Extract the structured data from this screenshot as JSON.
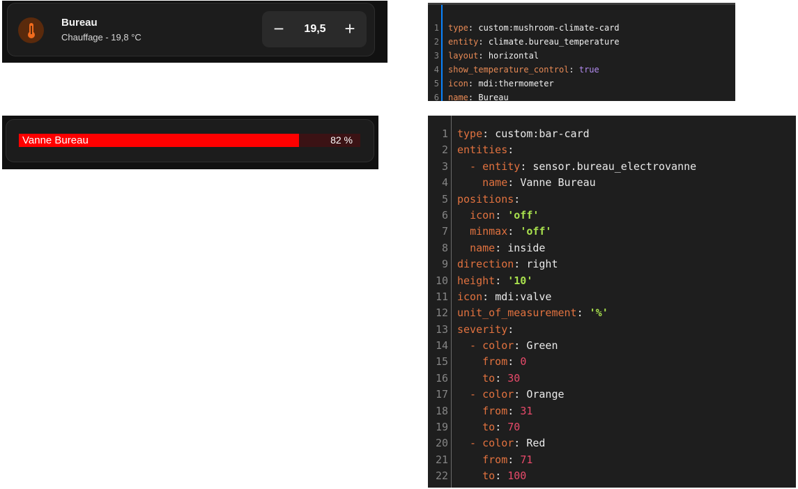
{
  "climate_card": {
    "name": "Bureau",
    "state": "Chauffage - 19,8 °C",
    "setpoint": "19,5",
    "minus_label": "−",
    "plus_label": "+",
    "icon": "thermometer-icon",
    "icon_color": "#f26b1d"
  },
  "bar_card": {
    "name": "Vanne Bureau",
    "value_text": "82 %",
    "percent": 82,
    "bar_color": "#ff0000"
  },
  "editor_mushroom": {
    "lines": [
      {
        "n": "1",
        "tokens": [
          {
            "t": "type",
            "c": "k"
          },
          {
            "t": ": ",
            "c": "v"
          },
          {
            "t": "custom:mushroom-climate-card",
            "c": "v"
          }
        ]
      },
      {
        "n": "2",
        "tokens": [
          {
            "t": "entity",
            "c": "k"
          },
          {
            "t": ": ",
            "c": "v"
          },
          {
            "t": "climate.bureau_temperature",
            "c": "v"
          }
        ]
      },
      {
        "n": "3",
        "tokens": [
          {
            "t": "layout",
            "c": "k"
          },
          {
            "t": ": ",
            "c": "v"
          },
          {
            "t": "horizontal",
            "c": "v"
          }
        ]
      },
      {
        "n": "4",
        "tokens": [
          {
            "t": "show_temperature_control",
            "c": "k"
          },
          {
            "t": ": ",
            "c": "v"
          },
          {
            "t": "true",
            "c": "b"
          }
        ]
      },
      {
        "n": "5",
        "tokens": [
          {
            "t": "icon",
            "c": "k"
          },
          {
            "t": ": ",
            "c": "v"
          },
          {
            "t": "mdi:thermometer",
            "c": "v"
          }
        ]
      },
      {
        "n": "6",
        "tokens": [
          {
            "t": "name",
            "c": "k"
          },
          {
            "t": ": ",
            "c": "v"
          },
          {
            "t": "Bureau",
            "c": "v"
          }
        ]
      }
    ]
  },
  "editor_barcard": {
    "lines": [
      {
        "n": "1",
        "tokens": [
          {
            "t": "type",
            "c": "k"
          },
          {
            "t": ": ",
            "c": "v"
          },
          {
            "t": "custom:bar-card",
            "c": "v"
          }
        ]
      },
      {
        "n": "2",
        "tokens": [
          {
            "t": "entities",
            "c": "k"
          },
          {
            "t": ":",
            "c": "v"
          }
        ]
      },
      {
        "n": "3",
        "tokens": [
          {
            "t": "  - ",
            "c": "k"
          },
          {
            "t": "entity",
            "c": "k"
          },
          {
            "t": ": ",
            "c": "v"
          },
          {
            "t": "sensor.bureau_electrovanne",
            "c": "v"
          }
        ]
      },
      {
        "n": "4",
        "tokens": [
          {
            "t": "    ",
            "c": "v"
          },
          {
            "t": "name",
            "c": "k"
          },
          {
            "t": ": ",
            "c": "v"
          },
          {
            "t": "Vanne Bureau",
            "c": "v"
          }
        ]
      },
      {
        "n": "5",
        "tokens": [
          {
            "t": "positions",
            "c": "k"
          },
          {
            "t": ":",
            "c": "v"
          }
        ]
      },
      {
        "n": "6",
        "tokens": [
          {
            "t": "  ",
            "c": "v"
          },
          {
            "t": "icon",
            "c": "k"
          },
          {
            "t": ": ",
            "c": "v"
          },
          {
            "t": "'off'",
            "c": "s"
          }
        ]
      },
      {
        "n": "7",
        "tokens": [
          {
            "t": "  ",
            "c": "v"
          },
          {
            "t": "minmax",
            "c": "k"
          },
          {
            "t": ": ",
            "c": "v"
          },
          {
            "t": "'off'",
            "c": "s"
          }
        ]
      },
      {
        "n": "8",
        "tokens": [
          {
            "t": "  ",
            "c": "v"
          },
          {
            "t": "name",
            "c": "k"
          },
          {
            "t": ": ",
            "c": "v"
          },
          {
            "t": "inside",
            "c": "v"
          }
        ]
      },
      {
        "n": "9",
        "tokens": [
          {
            "t": "direction",
            "c": "k"
          },
          {
            "t": ": ",
            "c": "v"
          },
          {
            "t": "right",
            "c": "v"
          }
        ]
      },
      {
        "n": "10",
        "tokens": [
          {
            "t": "height",
            "c": "k"
          },
          {
            "t": ": ",
            "c": "v"
          },
          {
            "t": "'10'",
            "c": "s"
          }
        ]
      },
      {
        "n": "11",
        "tokens": [
          {
            "t": "icon",
            "c": "k"
          },
          {
            "t": ": ",
            "c": "v"
          },
          {
            "t": "mdi:valve",
            "c": "v"
          }
        ]
      },
      {
        "n": "12",
        "tokens": [
          {
            "t": "unit_of_measurement",
            "c": "k"
          },
          {
            "t": ": ",
            "c": "v"
          },
          {
            "t": "'%'",
            "c": "s"
          }
        ]
      },
      {
        "n": "13",
        "tokens": [
          {
            "t": "severity",
            "c": "k"
          },
          {
            "t": ":",
            "c": "v"
          }
        ]
      },
      {
        "n": "14",
        "tokens": [
          {
            "t": "  - ",
            "c": "k"
          },
          {
            "t": "color",
            "c": "k"
          },
          {
            "t": ": ",
            "c": "v"
          },
          {
            "t": "Green",
            "c": "v"
          }
        ]
      },
      {
        "n": "15",
        "tokens": [
          {
            "t": "    ",
            "c": "v"
          },
          {
            "t": "from",
            "c": "k"
          },
          {
            "t": ": ",
            "c": "v"
          },
          {
            "t": "0",
            "c": "n"
          }
        ]
      },
      {
        "n": "16",
        "tokens": [
          {
            "t": "    ",
            "c": "v"
          },
          {
            "t": "to",
            "c": "k"
          },
          {
            "t": ": ",
            "c": "v"
          },
          {
            "t": "30",
            "c": "n"
          }
        ]
      },
      {
        "n": "17",
        "tokens": [
          {
            "t": "  - ",
            "c": "k"
          },
          {
            "t": "color",
            "c": "k"
          },
          {
            "t": ": ",
            "c": "v"
          },
          {
            "t": "Orange",
            "c": "v"
          }
        ]
      },
      {
        "n": "18",
        "tokens": [
          {
            "t": "    ",
            "c": "v"
          },
          {
            "t": "from",
            "c": "k"
          },
          {
            "t": ": ",
            "c": "v"
          },
          {
            "t": "31",
            "c": "n"
          }
        ]
      },
      {
        "n": "19",
        "tokens": [
          {
            "t": "    ",
            "c": "v"
          },
          {
            "t": "to",
            "c": "k"
          },
          {
            "t": ": ",
            "c": "v"
          },
          {
            "t": "70",
            "c": "n"
          }
        ]
      },
      {
        "n": "20",
        "tokens": [
          {
            "t": "  - ",
            "c": "k"
          },
          {
            "t": "color",
            "c": "k"
          },
          {
            "t": ": ",
            "c": "v"
          },
          {
            "t": "Red",
            "c": "v"
          }
        ]
      },
      {
        "n": "21",
        "tokens": [
          {
            "t": "    ",
            "c": "v"
          },
          {
            "t": "from",
            "c": "k"
          },
          {
            "t": ": ",
            "c": "v"
          },
          {
            "t": "71",
            "c": "n"
          }
        ]
      },
      {
        "n": "22",
        "tokens": [
          {
            "t": "    ",
            "c": "v"
          },
          {
            "t": "to",
            "c": "k"
          },
          {
            "t": ": ",
            "c": "v"
          },
          {
            "t": "100",
            "c": "n"
          }
        ]
      }
    ]
  }
}
